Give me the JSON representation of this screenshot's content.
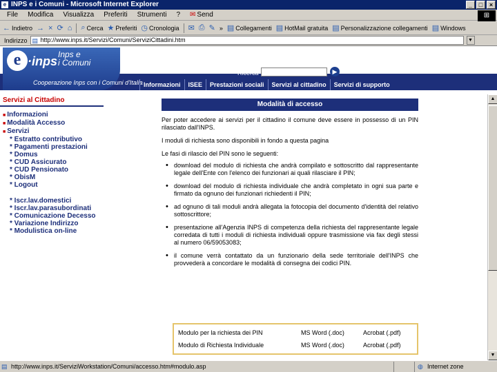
{
  "window": {
    "title": "INPS e i Comuni - Microsoft Internet Explorer",
    "controls": [
      "_",
      "□",
      "×"
    ]
  },
  "menubar": {
    "items": [
      "File",
      "Modifica",
      "Visualizza",
      "Preferiti",
      "Strumenti",
      "?"
    ],
    "send": "Send"
  },
  "toolbar": {
    "back": "Indietro",
    "forward": "→",
    "stop": "×",
    "refresh": "⟳",
    "home": "⌂",
    "search": "Cerca",
    "favorites": "Preferiti",
    "history": "Cronologia",
    "links_more": "»",
    "links": [
      "Collegamenti",
      "HotMail gratuita",
      "Personalizzazione collegamenti",
      "Windows"
    ]
  },
  "address": {
    "label": "Indirizzo",
    "value": "http://www.inps.it/Servizi/Comuni/ServiziCittadini.htm"
  },
  "banner": {
    "logo_e": "e",
    "logo_inps": "·inps",
    "tagline_line1": "Inps e",
    "tagline_line2": "i Comuni",
    "subtitle": "Cooperazione Inps con i Comuni d'Italia",
    "search_label": "Ricerca",
    "search_value": "",
    "nav_tabs": [
      "Informazioni",
      "ISEE",
      "Prestazioni sociali",
      "Servizi al cittadino",
      "Servizi di supporto"
    ]
  },
  "sidebar": {
    "heading": "Servizi al Cittadino",
    "main_items": [
      "Informazioni",
      "Modalità Accesso",
      "Servizi"
    ],
    "sub_items_1": [
      "Estratto contributivo",
      "Pagamenti prestazioni",
      "Domus",
      "CUD Assicurato",
      "CUD Pensionato",
      "ObisM",
      "Logout"
    ],
    "sub_items_2": [
      "Iscr.lav.domestici",
      "Iscr.lav.parasubordinati",
      "Comunicazione Decesso",
      "Variazione Indirizzo",
      "Modulistica on-line"
    ]
  },
  "content": {
    "heading": "Modalità di accesso",
    "para1": "Per poter accedere ai servizi per il cittadino il comune deve essere in possesso di un PIN rilasciato dall'INPS.",
    "para2": "I moduli di richiesta sono disponibili in fondo a questa pagina",
    "para3": "Le fasi di rilascio del PIN sono le seguenti:",
    "bullets": [
      "download del modulo di richiesta che andrà compilato e sottoscritto dal rappresentante legale dell'Ente con l'elenco dei funzionari ai quali rilasciare il PIN;",
      "download del modulo di richiesta individuale che andrà completato in ogni sua parte e firmato da ognuno dei funzionari richiedenti il PIN;",
      "ad ognuno di tali moduli andrà allegata la fotocopia del documento d'identità del relativo sottoscrittore;",
      "presentazione all'Agenzia INPS di competenza della richiesta del rappresentante legale corredata di tutti i moduli di richiesta individuali oppure trasmissione via fax degli stessi al numero 06/59053083;",
      "il comune verrà contattato da un funzionario della sede territoriale dell'INPS che provvederà a concordare le modalità di consegna dei codici PIN."
    ]
  },
  "forms": [
    {
      "name": "Modulo per la richiesta dei PIN",
      "word": "MS Word (.doc)",
      "pdf": "Acrobat (.pdf)"
    },
    {
      "name": "Modulo di Richiesta Individuale",
      "word": "MS Word (.doc)",
      "pdf": "Acrobat (.pdf)"
    }
  ],
  "status": {
    "url": "http://www.inps.it/ServiziWorkstation/Comuni/accesso.htm#modulo.asp",
    "zone": "Internet zone"
  },
  "colors": {
    "navy": "#1d2f7a",
    "accent_red": "#c80000",
    "form_border": "#e5c46a"
  }
}
